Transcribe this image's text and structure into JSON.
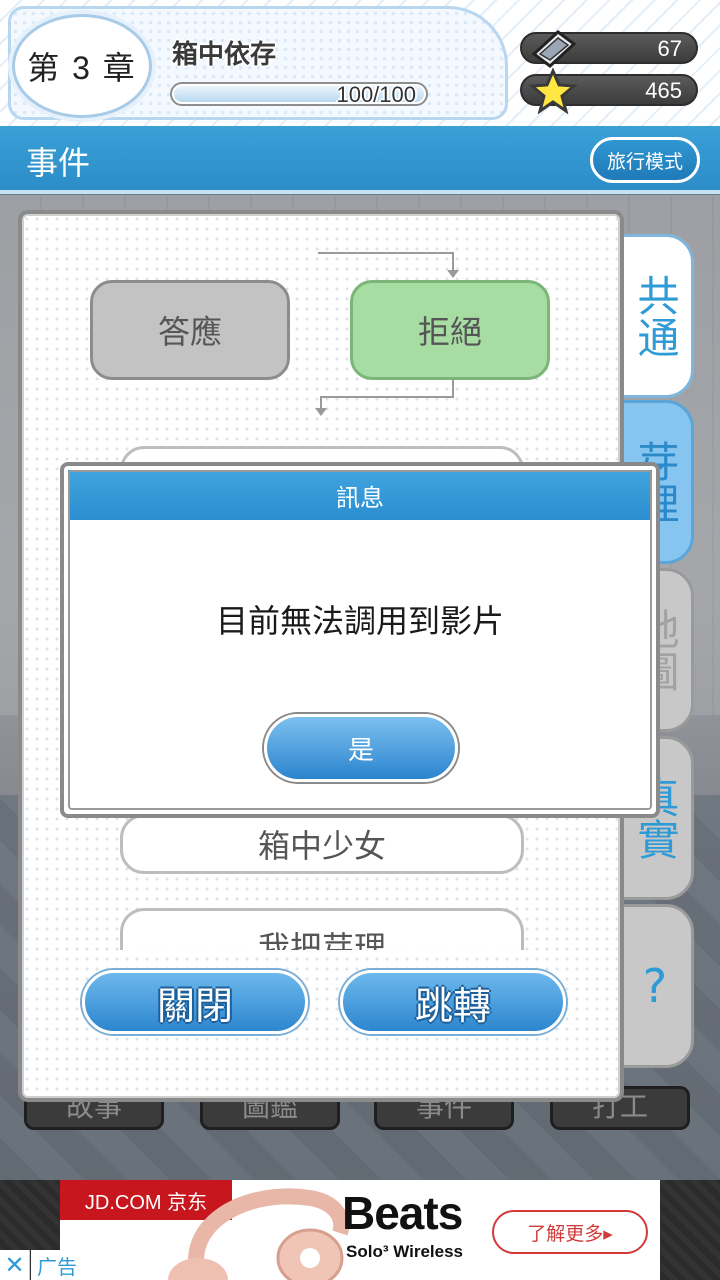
{
  "header": {
    "chapter_label": "第 3 章",
    "chapter_title": "箱中依存",
    "progress_text": "100/100",
    "progress_fraction": 1.0,
    "gems": "67",
    "stars": "465"
  },
  "section": {
    "title": "事件",
    "travel_mode_label": "旅行模式"
  },
  "flowchart": {
    "choice_accept": "答應",
    "choice_refuse": "拒絕",
    "story_node_top": "…",
    "story_node_box_girl": "箱中少女",
    "story_node_partial": "我把芽理"
  },
  "panel_buttons": {
    "close": "關閉",
    "jump": "跳轉"
  },
  "side_tabs": {
    "common": "共通",
    "meiri": "芽理",
    "map": "地圖",
    "truth": "真實",
    "help": "?"
  },
  "bottom_nav": {
    "story": "故事",
    "gallery": "圖鑑",
    "event": "事件",
    "work": "打工"
  },
  "dialog": {
    "title": "訊息",
    "message": "目前無法調用到影片",
    "confirm": "是"
  },
  "ad": {
    "advertiser": "JD.COM 京东",
    "brand": "Beats",
    "product": "Solo³ Wireless",
    "cta": "了解更多▸",
    "close": "✕",
    "label": "广告"
  },
  "colors": {
    "accent_blue": "#2c8dc8",
    "refuse_green": "#a7dca3",
    "ad_red": "#c7161d"
  }
}
